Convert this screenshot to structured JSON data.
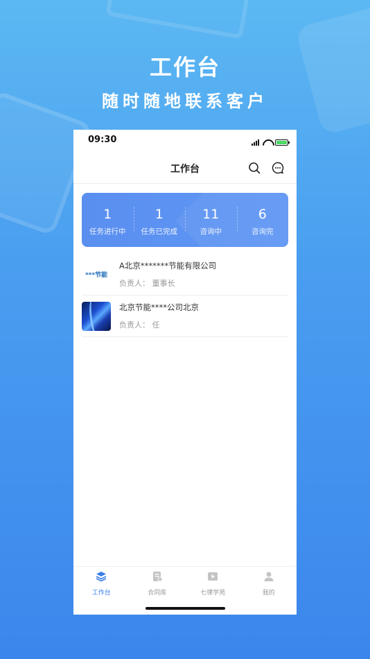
{
  "hero": {
    "title": "工作台",
    "subtitle": "随时随地联系客户"
  },
  "status_bar": {
    "time": "09:30"
  },
  "nav": {
    "title": "工作台",
    "search_icon": "search-icon",
    "message_icon": "chat-icon"
  },
  "stats": [
    {
      "value": "1",
      "label": "任务进行中"
    },
    {
      "value": "1",
      "label": "任务已完成"
    },
    {
      "value": "11",
      "label": "咨询中"
    },
    {
      "value": "6",
      "label": "咨询完"
    }
  ],
  "clients": [
    {
      "name": "A北京*******节能有限公司",
      "owner": "负责人：  董事长",
      "thumb_text": "***节能"
    },
    {
      "name": "北京节能****公司北京",
      "owner": "负责人：  任",
      "thumb_text": ""
    }
  ],
  "tabs": [
    {
      "label": "工作台",
      "icon": "layers-icon",
      "active": true
    },
    {
      "label": "合同库",
      "icon": "document-icon",
      "active": false
    },
    {
      "label": "七律学苑",
      "icon": "video-icon",
      "active": false
    },
    {
      "label": "我的",
      "icon": "user-icon",
      "active": false
    }
  ],
  "colors": {
    "accent": "#3b7fe6",
    "card": "#5a8ff0",
    "background_top": "#5cb8f2",
    "background_bottom": "#3b86ec"
  }
}
